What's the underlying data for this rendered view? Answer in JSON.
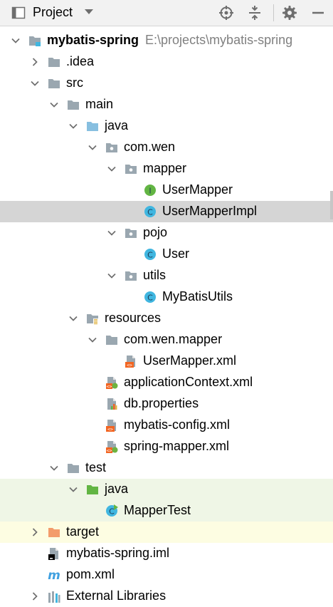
{
  "toolbar": {
    "title": "Project",
    "icons": [
      "project-view-icon",
      "locate-icon",
      "collapse-all-icon",
      "gear-icon",
      "hide-icon"
    ]
  },
  "tree": [
    {
      "label": "mybatis-spring",
      "path": "E:\\projects\\mybatis-spring",
      "icon": "module-folder-icon",
      "arrow": "down",
      "bold": true
    },
    {
      "label": ".idea",
      "icon": "folder-icon",
      "arrow": "right"
    },
    {
      "label": "src",
      "icon": "folder-icon",
      "arrow": "down"
    },
    {
      "label": "main",
      "icon": "folder-icon",
      "arrow": "down"
    },
    {
      "label": "java",
      "icon": "source-root-folder-icon",
      "arrow": "down"
    },
    {
      "label": "com.wen",
      "icon": "package-icon",
      "arrow": "down"
    },
    {
      "label": "mapper",
      "icon": "package-icon",
      "arrow": "down"
    },
    {
      "label": "UserMapper",
      "icon": "interface-icon"
    },
    {
      "label": "UserMapperImpl",
      "icon": "class-icon",
      "selected": true
    },
    {
      "label": "pojo",
      "icon": "package-icon",
      "arrow": "down"
    },
    {
      "label": "User",
      "icon": "class-icon"
    },
    {
      "label": "utils",
      "icon": "package-icon",
      "arrow": "down"
    },
    {
      "label": "MyBatisUtils",
      "icon": "class-icon"
    },
    {
      "label": "resources",
      "icon": "resources-folder-icon",
      "arrow": "down"
    },
    {
      "label": "com.wen.mapper",
      "icon": "folder-icon",
      "arrow": "down"
    },
    {
      "label": "UserMapper.xml",
      "icon": "xml-file-icon"
    },
    {
      "label": "applicationContext.xml",
      "icon": "spring-xml-file-icon"
    },
    {
      "label": "db.properties",
      "icon": "properties-file-icon"
    },
    {
      "label": "mybatis-config.xml",
      "icon": "xml-file-icon"
    },
    {
      "label": "spring-mapper.xml",
      "icon": "spring-xml-file-icon"
    },
    {
      "label": "test",
      "icon": "folder-icon",
      "arrow": "down"
    },
    {
      "label": "java",
      "icon": "test-root-folder-icon",
      "arrow": "down",
      "bg": "test"
    },
    {
      "label": "MapperTest",
      "icon": "test-class-icon",
      "bg": "test"
    },
    {
      "label": "target",
      "icon": "excluded-folder-icon",
      "arrow": "right",
      "bg": "excluded"
    },
    {
      "label": "mybatis-spring.iml",
      "icon": "iml-file-icon"
    },
    {
      "label": "pom.xml",
      "icon": "maven-file-icon"
    },
    {
      "label": "External Libraries",
      "icon": "libraries-icon",
      "arrow": "right"
    }
  ]
}
